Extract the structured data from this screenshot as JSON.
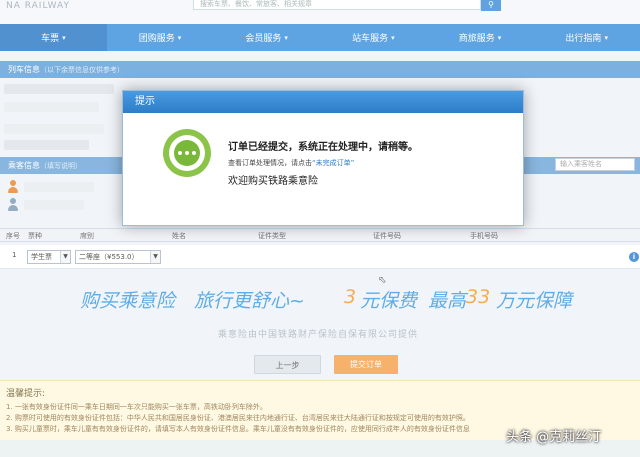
{
  "header": {
    "logo_text": "NA RAILWAY",
    "search_placeholder": "搜索车票、餐饮、常旅客、相关规章",
    "search_icon": "search-icon"
  },
  "nav": {
    "items": [
      {
        "label": "车票"
      },
      {
        "label": "团购服务"
      },
      {
        "label": "会员服务"
      },
      {
        "label": "站车服务"
      },
      {
        "label": "商旅服务"
      },
      {
        "label": "出行指南"
      }
    ],
    "active_index": 0,
    "caret": "▾"
  },
  "train_info": {
    "title": "列车信息",
    "hint": "（以下余票信息仅供参考）"
  },
  "passenger_info": {
    "title": "乘客信息",
    "hint": "（填写说明）",
    "search_placeholder": "输入乘客姓名"
  },
  "table": {
    "headers": [
      "序号",
      "票种",
      "席别",
      "姓名",
      "证件类型",
      "证件号码",
      "手机号码"
    ],
    "rows": [
      {
        "index": "1",
        "ticket_type": "学生票",
        "seat": "二等座（¥553.0）"
      }
    ]
  },
  "insurance": {
    "slogan1": "购买乘意险",
    "slogan2": "旅行更舒心~",
    "price_prefix": "3",
    "price_suffix": "元保费",
    "max_prefix": "最高",
    "max_amount": "33",
    "max_suffix": "万元保障",
    "provider": "乘意险由中国铁路财产保险自保有限公司提供"
  },
  "buttons": {
    "prev": "上一步",
    "submit": "提交订单"
  },
  "tips": {
    "title": "温馨提示:",
    "lines": [
      "1. 一张有效身份证件同一乘车日期同一车次只能购买一张车票，高铁动卧列车除外。",
      "2. 购票时可使用的有效身份证件包括：中华人民共和国居民身份证、港澳居民来往内地通行证、台湾居民来往大陆通行证和按规定可使用的有效护照。",
      "3. 购买儿童票时，乘车儿童有有效身份证件的，请填写本人有效身份证件信息。乘车儿童没有有效身份证件的，应使用同行成年人的有效身份证件信息"
    ]
  },
  "modal": {
    "title": "提示",
    "main_message": "订单已经提交，系统正在处理中，请稍等。",
    "sub_prefix": "查看订单处理情况，请点击",
    "sub_link": "“未完成订单”",
    "welcome": "欢迎购买铁路乘意险"
  },
  "watermark": "头条 @克莉丝汀",
  "colors": {
    "nav_blue": "#3b90dc",
    "section_blue": "#5f9fd8",
    "insurance_blue": "#3b9be3",
    "insurance_orange": "#f79a2e",
    "success_green": "#8cc44a",
    "submit_orange": "#f5a24a"
  }
}
